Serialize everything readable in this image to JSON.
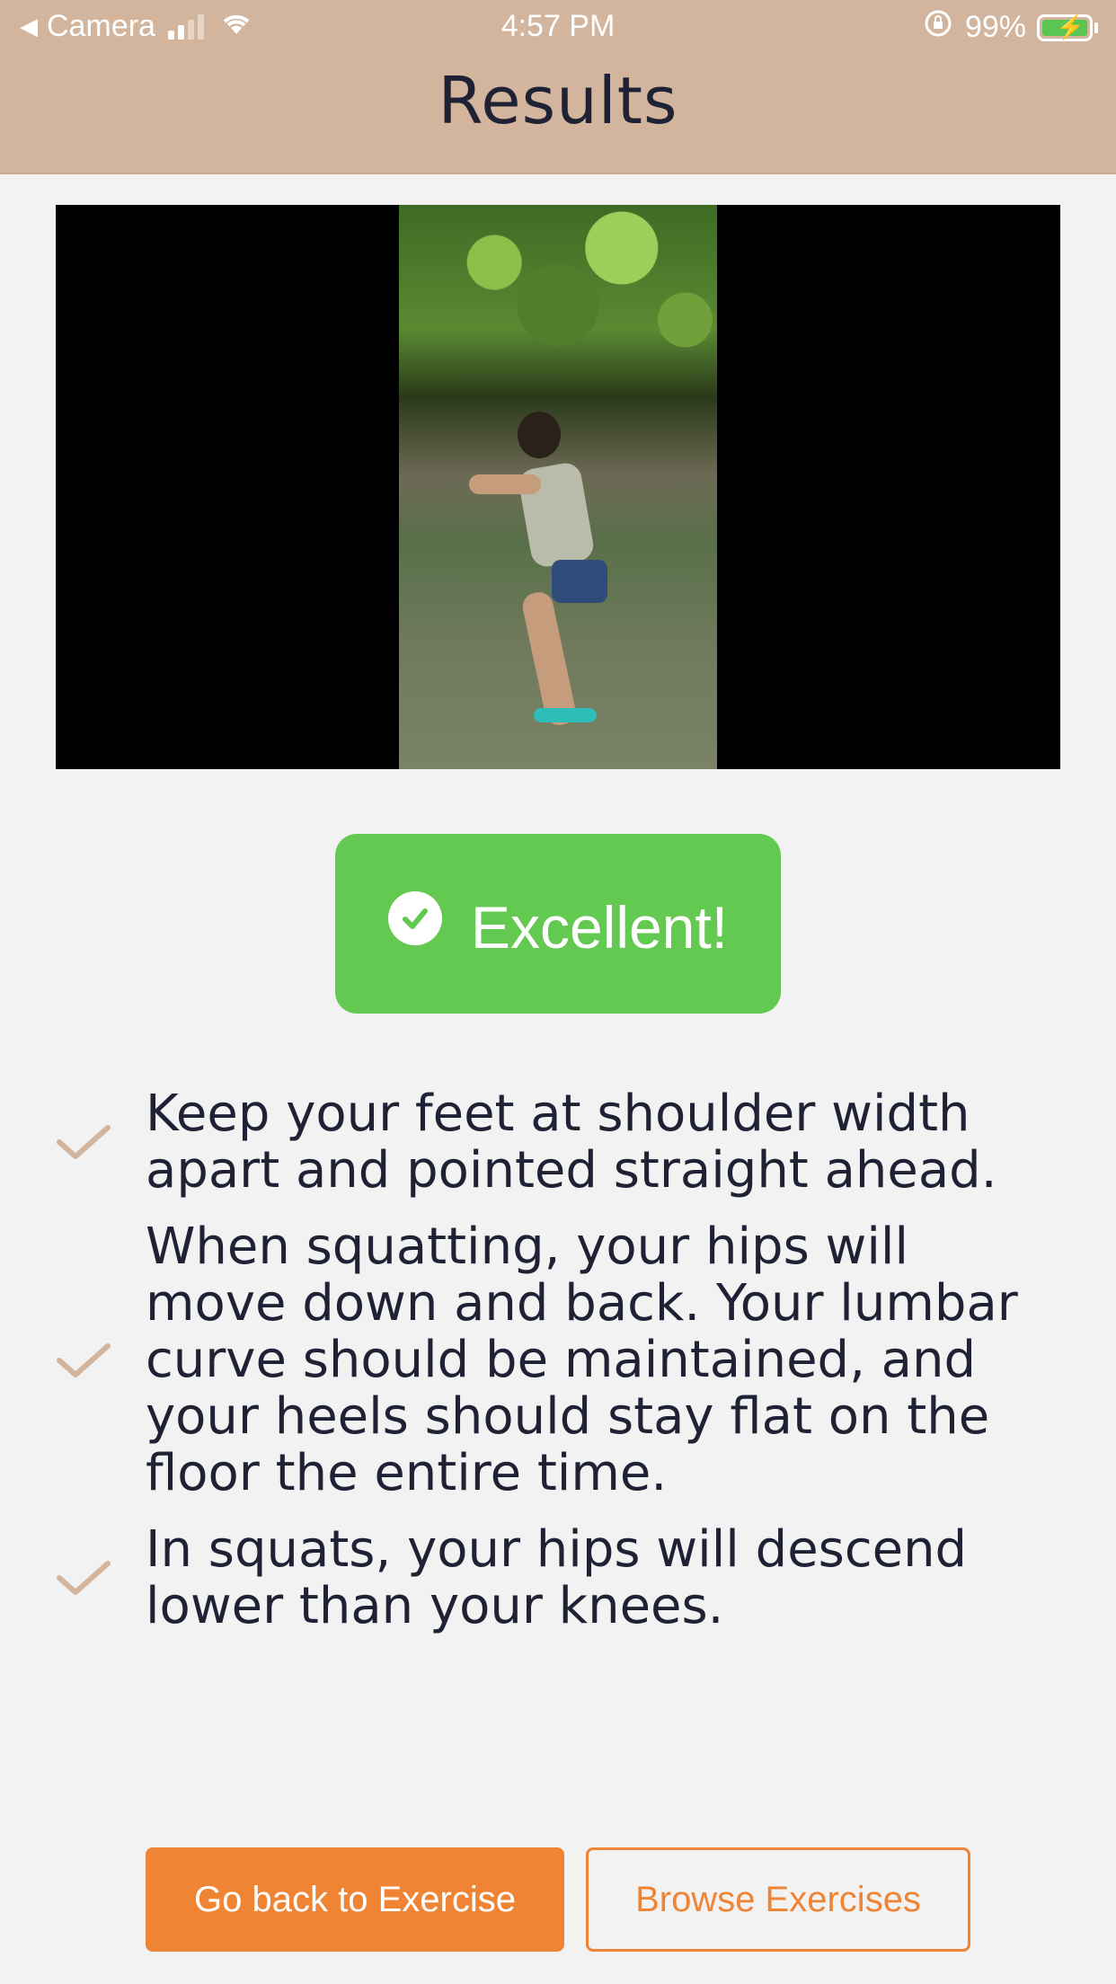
{
  "status_bar": {
    "back_app": "Camera",
    "time": "4:57 PM",
    "battery": "99%"
  },
  "header": {
    "title": "Results"
  },
  "result_badge": {
    "label": "Excellent!",
    "color": "#64c950"
  },
  "tips": [
    {
      "text": "Keep your feet at shoulder width apart and pointed straight ahead."
    },
    {
      "text": "When squatting, your hips will move down and back. Your lumbar curve should be maintained, and your heels should stay flat on the floor the entire time."
    },
    {
      "text": "In squats, your hips will descend lower than your knees."
    }
  ],
  "actions": {
    "primary_label": "Go back to Exercise",
    "secondary_label": "Browse Exercises"
  },
  "colors": {
    "header_bg": "#d2b59c",
    "accent": "#ef8434",
    "check": "#d2b59c"
  }
}
